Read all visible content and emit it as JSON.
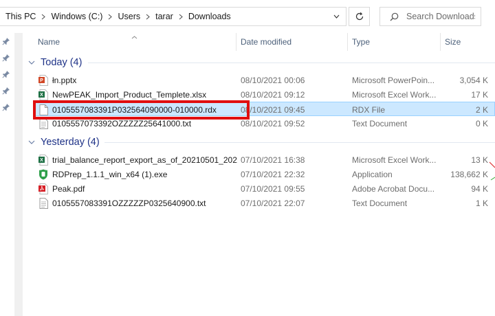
{
  "address_bar": {
    "crumbs": [
      "This PC",
      "Windows (C:)",
      "Users",
      "tarar",
      "Downloads"
    ]
  },
  "search": {
    "placeholder": "Search Downloads"
  },
  "columns": {
    "name": "Name",
    "date": "Date modified",
    "type": "Type",
    "size": "Size"
  },
  "groups": [
    {
      "label": "Today (4)",
      "files": [
        {
          "name": "łn.pptx",
          "date": "08/10/2021 00:06",
          "type": "Microsoft PowerPoin...",
          "size": "3,054 K",
          "icon": "powerpoint-file-icon",
          "selected": false
        },
        {
          "name": "NewPEAK_Import_Product_Templete.xlsx",
          "date": "08/10/2021 09:12",
          "type": "Microsoft Excel Work...",
          "size": "17 K",
          "icon": "excel-file-icon",
          "selected": false
        },
        {
          "name": "0105557083391P032564090000-010000.rdx",
          "date": "08/10/2021 09:45",
          "type": "RDX File",
          "size": "2 K",
          "icon": "generic-file-icon",
          "selected": true
        },
        {
          "name": "0105557073392OZZZZZ25641000.txt",
          "date": "08/10/2021 09:52",
          "type": "Text Document",
          "size": "0 K",
          "icon": "text-file-icon",
          "selected": false
        }
      ]
    },
    {
      "label": "Yesterday (4)",
      "files": [
        {
          "name": "trial_balance_report_export_as_of_20210501_202...",
          "date": "07/10/2021 16:38",
          "type": "Microsoft Excel Work...",
          "size": "13 K",
          "icon": "excel-file-icon",
          "selected": false
        },
        {
          "name": "RDPrep_1.1.1_win_x64 (1).exe",
          "date": "07/10/2021 22:32",
          "type": "Application",
          "size": "138,662 K",
          "icon": "application-icon",
          "selected": false
        },
        {
          "name": "Peak.pdf",
          "date": "07/10/2021 09:55",
          "type": "Adobe Acrobat Docu...",
          "size": "94 K",
          "icon": "pdf-file-icon",
          "selected": false
        },
        {
          "name": "0105557083391OZZZZZP0325640900.txt",
          "date": "07/10/2021 22:07",
          "type": "Text Document",
          "size": "1 K",
          "icon": "text-file-icon",
          "selected": false
        }
      ]
    }
  ],
  "colors": {
    "group_label": "#1e3287",
    "selection_bg": "#cce8ff",
    "selection_border": "#99d1ff",
    "highlight_box": "#e00f0f",
    "column_header_text": "#4c607a"
  }
}
